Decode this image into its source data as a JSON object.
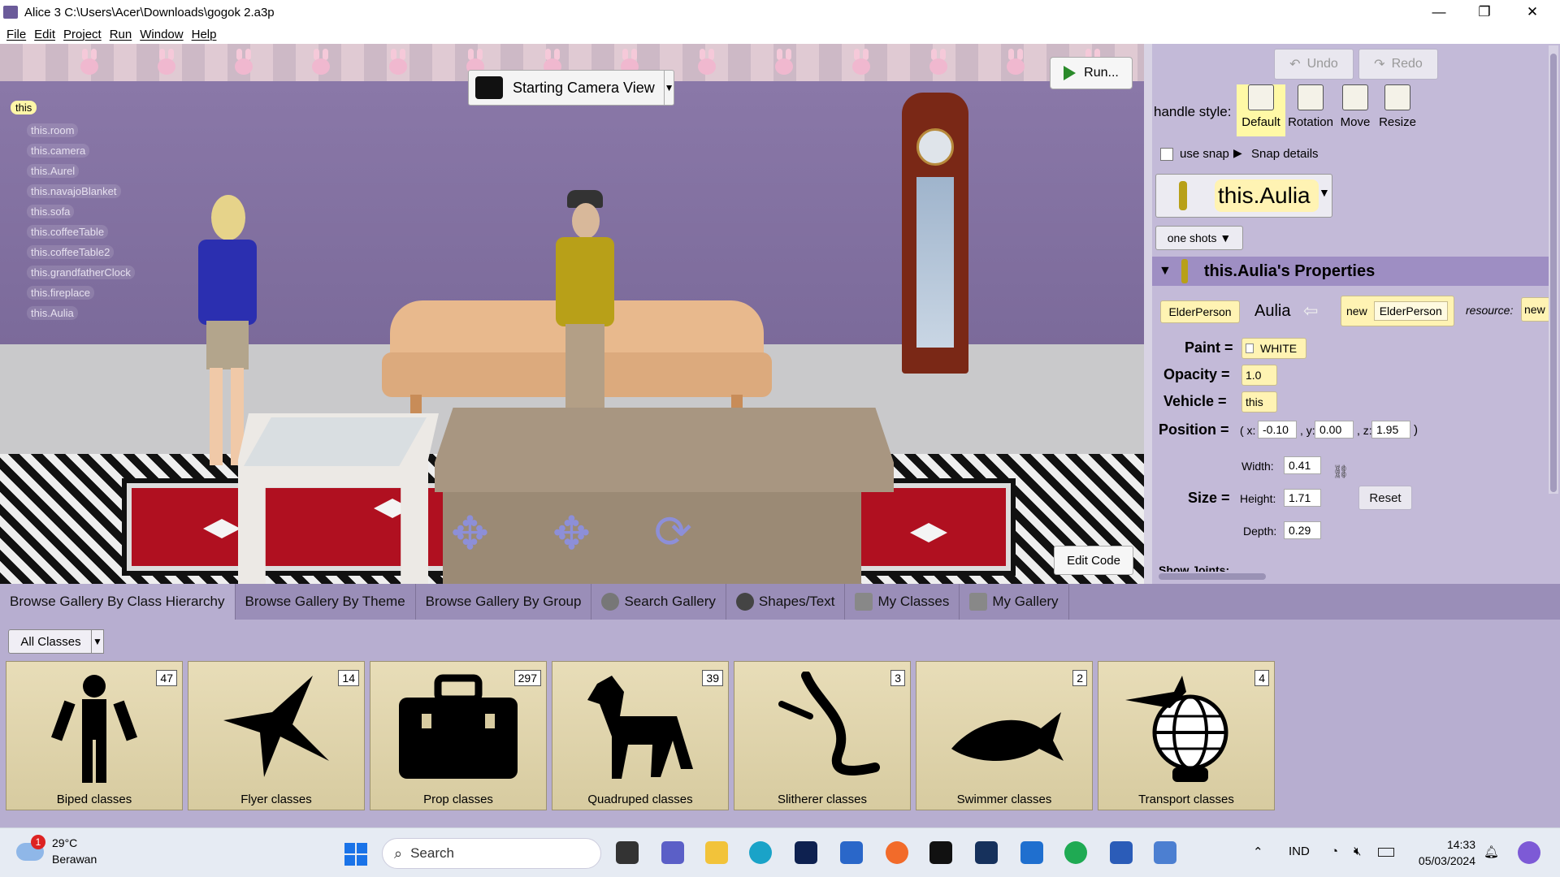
{
  "window": {
    "title": "Alice 3 C:\\Users\\Acer\\Downloads\\gogok 2.a3p",
    "minimize": "—",
    "restore": "❐",
    "close": "✕"
  },
  "menu": [
    "File",
    "Edit",
    "Project",
    "Run",
    "Window",
    "Help"
  ],
  "scene": {
    "root": "this",
    "objects": [
      "this.room",
      "this.camera",
      "this.Aurel",
      "this.navajoBlanket",
      "this.sofa",
      "this.coffeeTable",
      "this.coffeeTable2",
      "this.grandfatherClock",
      "this.fireplace",
      "this.Aulia"
    ],
    "camera_view": "Starting Camera View",
    "run_label": "Run...",
    "edit_code_label": "Edit Code"
  },
  "right_panel": {
    "undo": "Undo",
    "redo": "Redo",
    "handle_style_label": "handle style:",
    "handle_styles": [
      "Default",
      "Rotation",
      "Move",
      "Resize"
    ],
    "selected_handle_style": "Default",
    "use_snap": "use snap",
    "snap_details": "Snap details",
    "selected_object": "this.Aulia",
    "one_shots": "one shots",
    "properties_title": "this.Aulia's Properties",
    "class_tile": "ElderPerson",
    "instance_name": "Aulia",
    "new_label": "new",
    "new_class": "ElderPerson",
    "resource_label": "resource:",
    "resource_value": "new",
    "paint_label": "Paint =",
    "paint_value": "WHITE",
    "opacity_label": "Opacity =",
    "opacity_value": "1.0",
    "vehicle_label": "Vehicle =",
    "vehicle_value": "this",
    "position_label": "Position =",
    "pos_x_label": "( x:",
    "pos_x": "-0.10",
    "pos_y_label": ", y:",
    "pos_y": "0.00",
    "pos_z_label": ", z:",
    "pos_z": "1.95",
    "pos_close": ")",
    "size_label": "Size =",
    "width_label": "Width:",
    "width": "0.41",
    "height_label": "Height:",
    "height": "1.71",
    "depth_label": "Depth:",
    "depth": "0.29",
    "reset": "Reset",
    "show_joints": "Show Joints:"
  },
  "gallery": {
    "tabs": [
      "Browse Gallery By Class Hierarchy",
      "Browse Gallery By Theme",
      "Browse Gallery By Group",
      "Search Gallery",
      "Shapes/Text",
      "My Classes",
      "My Gallery"
    ],
    "filter": "All Classes",
    "cards": [
      {
        "label": "Biped classes",
        "count": "47",
        "icon": "biped-icon"
      },
      {
        "label": "Flyer classes",
        "count": "14",
        "icon": "bird-icon"
      },
      {
        "label": "Prop classes",
        "count": "297",
        "icon": "toolbox-icon"
      },
      {
        "label": "Quadruped classes",
        "count": "39",
        "icon": "dog-icon"
      },
      {
        "label": "Slitherer classes",
        "count": "3",
        "icon": "snake-icon"
      },
      {
        "label": "Swimmer classes",
        "count": "2",
        "icon": "fish-icon"
      },
      {
        "label": "Transport classes",
        "count": "4",
        "icon": "globe-icon"
      }
    ]
  },
  "taskbar": {
    "weather_badge": "1",
    "temperature": "29°C",
    "weather": "Berawan",
    "search": "Search",
    "language": "IND",
    "time": "14:33",
    "date": "05/03/2024"
  }
}
